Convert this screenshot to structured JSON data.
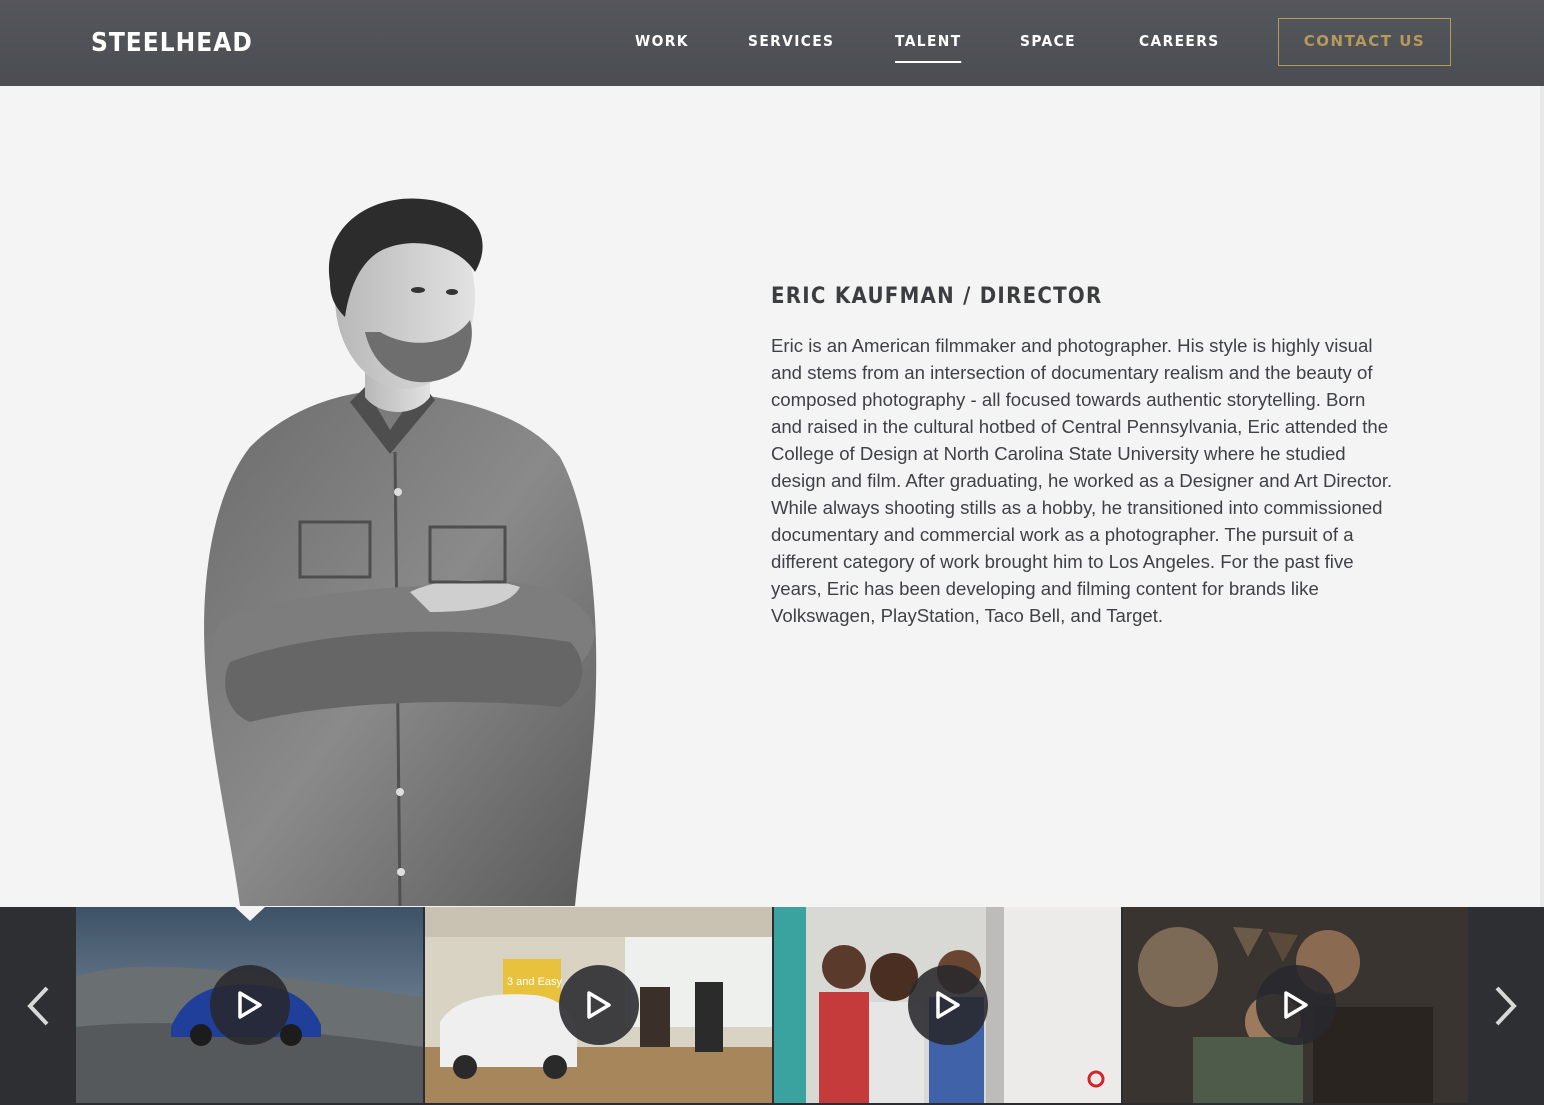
{
  "brand": {
    "logo_text": "STEELHEAD"
  },
  "nav": {
    "items": [
      {
        "label": "WORK"
      },
      {
        "label": "SERVICES"
      },
      {
        "label": "TALENT"
      },
      {
        "label": "SPACE"
      },
      {
        "label": "CAREERS"
      }
    ],
    "active": "TALENT",
    "contact_label": "CONTACT US"
  },
  "colors": {
    "header_bg": "#4f5256",
    "accent_gold": "#b79a5a",
    "page_bg": "#f4f4f4",
    "carousel_bg": "#2b2d30"
  },
  "profile": {
    "title": "ERIC KAUFMAN / DIRECTOR",
    "bio": "Eric is an American filmmaker and photographer. His style is highly visual and stems from an intersection of documentary realism and the beauty of composed photography - all focused towards authentic storytelling. Born and raised in the cultural hotbed of Central Pennsylvania, Eric attended the College of Design at North Carolina State University where he studied design and film. After graduating, he worked as a Designer and Art Director. While always shooting stills as a hobby, he transitioned into commissioned documentary and commercial work as a photographer. The pursuit of a different category of work brought him to Los Angeles. For the past five years, Eric has been developing and filming content for brands like Volkswagen, PlayStation, Taco Bell, and Target."
  },
  "carousel": {
    "prev_icon": "chevron-left-icon",
    "next_icon": "chevron-right-icon",
    "play_icon": "play-icon",
    "selected_index": 0,
    "thumbnails": [
      {
        "scene": "blue-car-desert-road"
      },
      {
        "scene": "car-dealership-showroom",
        "sign_text": "3 and Easy"
      },
      {
        "scene": "children-in-doorway"
      },
      {
        "scene": "parent-reading-to-child"
      }
    ]
  }
}
